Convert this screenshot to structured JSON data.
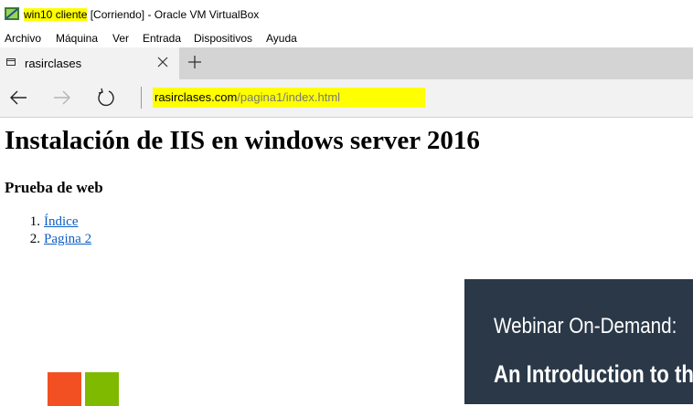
{
  "window": {
    "vm_name": "win10 cliente",
    "status": "[Corriendo]",
    "app": "- Oracle VM VirtualBox"
  },
  "menu": [
    "Archivo",
    "Máquina",
    "Ver",
    "Entrada",
    "Dispositivos",
    "Ayuda"
  ],
  "browser": {
    "tab_title": "rasirclases",
    "address_host": "rasirclases.com",
    "address_path": "/pagina1/index.html"
  },
  "page": {
    "heading": "Instalación de IIS en windows server 2016",
    "subheading": "Prueba de web",
    "links": [
      {
        "num": "1.",
        "label": "Índice"
      },
      {
        "num": "2.",
        "label": "Pagina 2"
      }
    ],
    "ad": {
      "line1": "Webinar On-Demand:",
      "line2": "An Introduction to th"
    }
  },
  "colors": {
    "highlight": "#ffff00",
    "link": "#0b5fc4",
    "ad_background": "#2a3848"
  }
}
